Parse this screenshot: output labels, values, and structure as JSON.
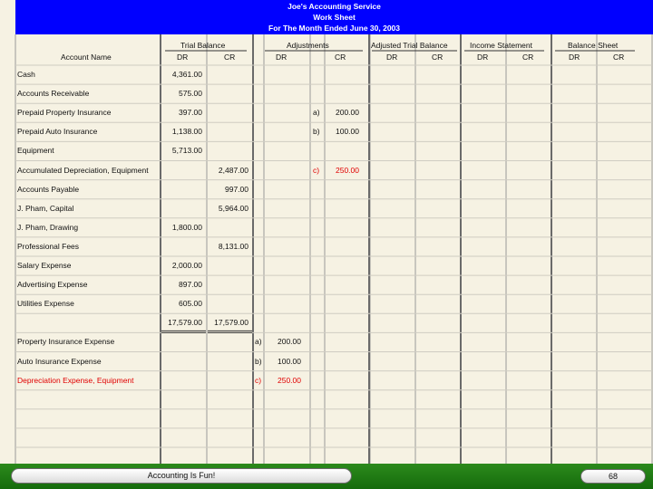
{
  "header": {
    "company": "Joe's Accounting Service",
    "title": "Work Sheet",
    "period": "For The Month Ended June 30, 2003"
  },
  "columns": {
    "account_name": "Account Name",
    "trial_balance": "Trial Balance",
    "adjustments": "Adjustments",
    "adjusted_trial_balance": "Adjusted Trial Balance",
    "income_statement": "Income Statement",
    "balance_sheet": "Balance Sheet",
    "dr": "DR",
    "cr": "CR"
  },
  "rows": [
    {
      "account": "Cash",
      "tb_dr": "4,361.00",
      "tb_cr": "",
      "adj_dr_ref": "",
      "adj_dr": "",
      "adj_cr_ref": "",
      "adj_cr": "",
      "red": false
    },
    {
      "account": "Accounts Receivable",
      "tb_dr": "575.00",
      "tb_cr": "",
      "adj_dr_ref": "",
      "adj_dr": "",
      "adj_cr_ref": "",
      "adj_cr": "",
      "red": false
    },
    {
      "account": "Prepaid Property Insurance",
      "tb_dr": "397.00",
      "tb_cr": "",
      "adj_dr_ref": "",
      "adj_dr": "",
      "adj_cr_ref": "a)",
      "adj_cr": "200.00",
      "red": false
    },
    {
      "account": "Prepaid Auto Insurance",
      "tb_dr": "1,138.00",
      "tb_cr": "",
      "adj_dr_ref": "",
      "adj_dr": "",
      "adj_cr_ref": "b)",
      "adj_cr": "100.00",
      "red": false
    },
    {
      "account": "Equipment",
      "tb_dr": "5,713.00",
      "tb_cr": "",
      "adj_dr_ref": "",
      "adj_dr": "",
      "adj_cr_ref": "",
      "adj_cr": "",
      "red": false
    },
    {
      "account": "Accumulated Depreciation, Equipment",
      "tb_dr": "",
      "tb_cr": "2,487.00",
      "adj_dr_ref": "",
      "adj_dr": "",
      "adj_cr_ref": "c)",
      "adj_cr": "250.00",
      "red": false,
      "red_adj": true
    },
    {
      "account": "Accounts Payable",
      "tb_dr": "",
      "tb_cr": "997.00",
      "adj_dr_ref": "",
      "adj_dr": "",
      "adj_cr_ref": "",
      "adj_cr": "",
      "red": false
    },
    {
      "account": "J. Pham, Capital",
      "tb_dr": "",
      "tb_cr": "5,964.00",
      "adj_dr_ref": "",
      "adj_dr": "",
      "adj_cr_ref": "",
      "adj_cr": "",
      "red": false
    },
    {
      "account": "J. Pham, Drawing",
      "tb_dr": "1,800.00",
      "tb_cr": "",
      "adj_dr_ref": "",
      "adj_dr": "",
      "adj_cr_ref": "",
      "adj_cr": "",
      "red": false
    },
    {
      "account": "Professional Fees",
      "tb_dr": "",
      "tb_cr": "8,131.00",
      "adj_dr_ref": "",
      "adj_dr": "",
      "adj_cr_ref": "",
      "adj_cr": "",
      "red": false
    },
    {
      "account": "Salary Expense",
      "tb_dr": "2,000.00",
      "tb_cr": "",
      "adj_dr_ref": "",
      "adj_dr": "",
      "adj_cr_ref": "",
      "adj_cr": "",
      "red": false
    },
    {
      "account": "Advertising Expense",
      "tb_dr": "897.00",
      "tb_cr": "",
      "adj_dr_ref": "",
      "adj_dr": "",
      "adj_cr_ref": "",
      "adj_cr": "",
      "red": false
    },
    {
      "account": "Utilities Expense",
      "tb_dr": "605.00",
      "tb_cr": "",
      "adj_dr_ref": "",
      "adj_dr": "",
      "adj_cr_ref": "",
      "adj_cr": "",
      "red": false
    },
    {
      "account": "",
      "tb_dr": "17,579.00",
      "tb_cr": "17,579.00",
      "adj_dr_ref": "",
      "adj_dr": "",
      "adj_cr_ref": "",
      "adj_cr": "",
      "red": false,
      "total": true
    },
    {
      "account": "Property Insurance Expense",
      "tb_dr": "",
      "tb_cr": "",
      "adj_dr_ref": "a)",
      "adj_dr": "200.00",
      "adj_cr_ref": "",
      "adj_cr": "",
      "red": false
    },
    {
      "account": "Auto Insurance Expense",
      "tb_dr": "",
      "tb_cr": "",
      "adj_dr_ref": "b)",
      "adj_dr": "100.00",
      "adj_cr_ref": "",
      "adj_cr": "",
      "red": false
    },
    {
      "account": "Depreciation Expense, Equipment",
      "tb_dr": "",
      "tb_cr": "",
      "adj_dr_ref": "c)",
      "adj_dr": "250.00",
      "adj_cr_ref": "",
      "adj_cr": "",
      "red": true,
      "red_adj": true
    },
    {
      "account": "",
      "tb_dr": "",
      "tb_cr": "",
      "adj_dr_ref": "",
      "adj_dr": "",
      "adj_cr_ref": "",
      "adj_cr": "",
      "red": false
    },
    {
      "account": "",
      "tb_dr": "",
      "tb_cr": "",
      "adj_dr_ref": "",
      "adj_dr": "",
      "adj_cr_ref": "",
      "adj_cr": "",
      "red": false
    },
    {
      "account": "",
      "tb_dr": "",
      "tb_cr": "",
      "adj_dr_ref": "",
      "adj_dr": "",
      "adj_cr_ref": "",
      "adj_cr": "",
      "red": false
    },
    {
      "account": "",
      "tb_dr": "",
      "tb_cr": "",
      "adj_dr_ref": "",
      "adj_dr": "",
      "adj_cr_ref": "",
      "adj_cr": "",
      "red": false
    }
  ],
  "footer": {
    "slogan": "Accounting Is Fun!",
    "page_number": "68"
  },
  "colors": {
    "header_bg": "#0000ff",
    "header_text": "#ffffff",
    "red_text": "#e00000",
    "footer_bg": "#1f7c14"
  }
}
